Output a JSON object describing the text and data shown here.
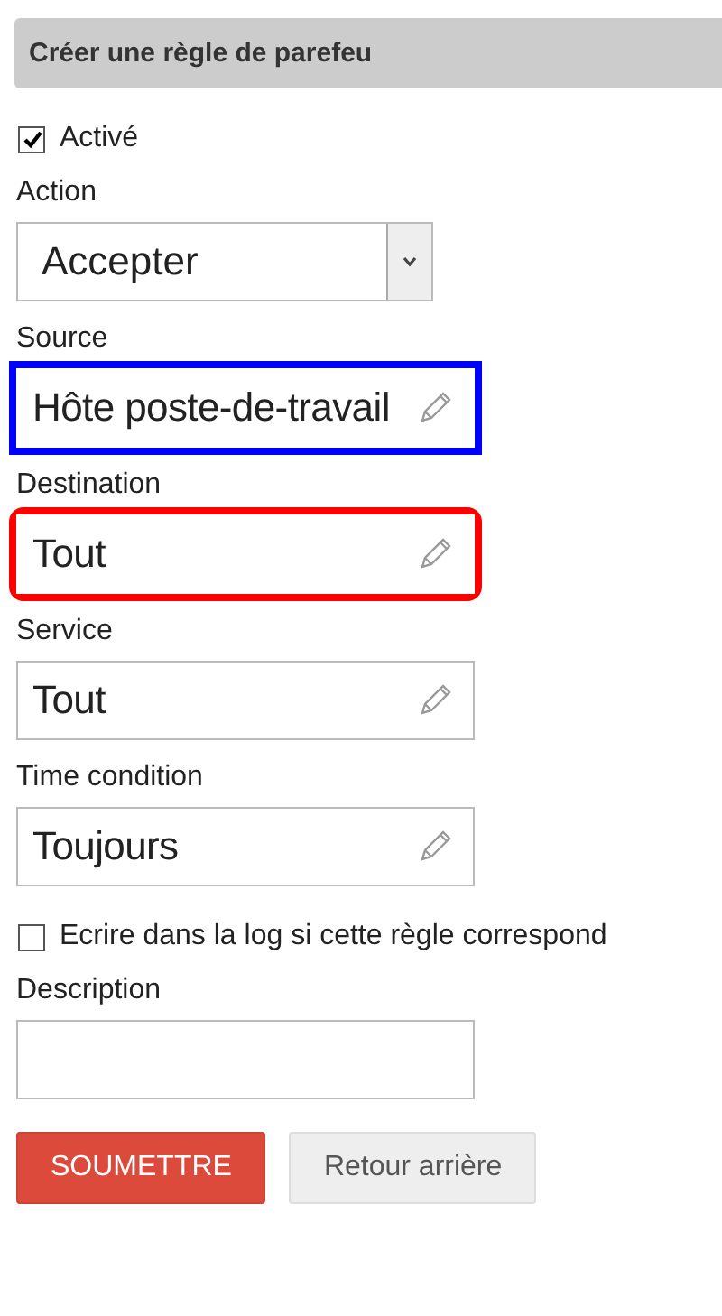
{
  "panel": {
    "title": "Créer une règle de parefeu"
  },
  "fields": [
    {
      "kind": "checkbox",
      "label": "Activé",
      "checked": true
    },
    {
      "kind": "select",
      "label": "Action",
      "value": "Accepter"
    },
    {
      "kind": "picker",
      "label": "Source",
      "value": "Hôte poste-de-travail",
      "color": "#0000ff"
    },
    {
      "kind": "picker",
      "label": "Destination",
      "value": "Tout",
      "color": "#ff0000"
    },
    {
      "kind": "picker",
      "label": "Service",
      "value": "Tout"
    },
    {
      "kind": "picker",
      "label": "Time condition",
      "value": "Toujours"
    },
    {
      "kind": "checkbox",
      "label": "Ecrire dans la log si cette règle correspond",
      "checked": false
    },
    {
      "kind": "text",
      "label": "Description"
    }
  ],
  "buttons": [
    {
      "kind": "primary",
      "label": "SOUMETTRE"
    },
    {
      "kind": "secondary",
      "label": "Retour arrière"
    }
  ]
}
